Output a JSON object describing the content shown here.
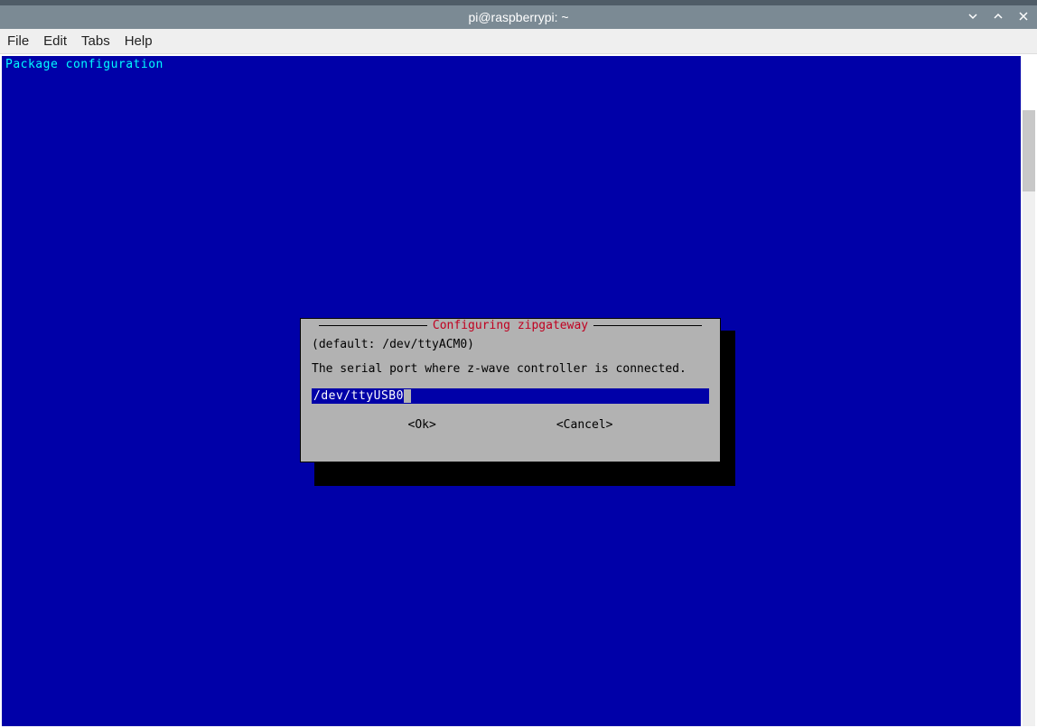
{
  "window": {
    "title": "pi@raspberrypi: ~"
  },
  "menubar": {
    "file": "File",
    "edit": "Edit",
    "tabs": "Tabs",
    "help": "Help"
  },
  "terminal": {
    "header": "Package configuration"
  },
  "dialog": {
    "title": "Configuring zipgateway",
    "default_hint": "(default: /dev/ttyACM0)",
    "prompt": "The serial port where z-wave controller is connected.",
    "input_value": "/dev/ttyUSB0",
    "ok_label": "<Ok>",
    "cancel_label": "<Cancel>"
  }
}
